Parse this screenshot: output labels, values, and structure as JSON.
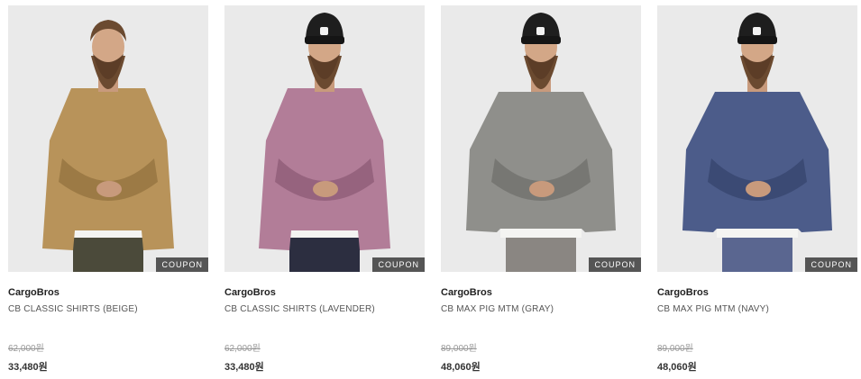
{
  "products": [
    {
      "brand": "CargoBros",
      "name": "CB CLASSIC SHIRTS (BEIGE)",
      "original_price": "62,000원",
      "sale_price": "33,480원",
      "badge": "COUPON",
      "garment_color": "#b8935a",
      "garment_shadow": "#9c7a45",
      "has_beanie": false,
      "top_type": "shirt",
      "bottom_color": "#4b4a3a"
    },
    {
      "brand": "CargoBros",
      "name": "CB CLASSIC SHIRTS (LAVENDER)",
      "original_price": "62,000원",
      "sale_price": "33,480원",
      "badge": "COUPON",
      "garment_color": "#b27d98",
      "garment_shadow": "#96637e",
      "has_beanie": true,
      "top_type": "shirt",
      "bottom_color": "#2c2e40"
    },
    {
      "brand": "CargoBros",
      "name": "CB MAX PIG MTM (GRAY)",
      "original_price": "89,000원",
      "sale_price": "48,060원",
      "badge": "COUPON",
      "garment_color": "#8f8f8b",
      "garment_shadow": "#777773",
      "has_beanie": true,
      "top_type": "sweat",
      "bottom_color": "#8a8682"
    },
    {
      "brand": "CargoBros",
      "name": "CB MAX PIG MTM (NAVY)",
      "original_price": "89,000원",
      "sale_price": "48,060원",
      "badge": "COUPON",
      "garment_color": "#4c5c8a",
      "garment_shadow": "#3b4a74",
      "has_beanie": true,
      "top_type": "sweat",
      "bottom_color": "#5a6690"
    }
  ]
}
